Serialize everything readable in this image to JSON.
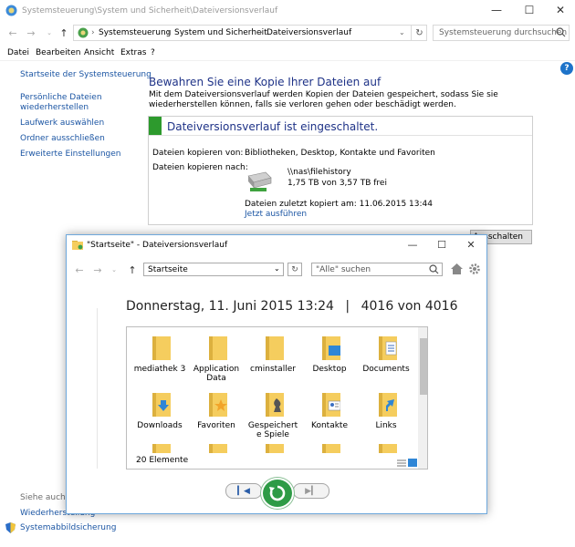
{
  "window": {
    "title": "Systemsteuerung\\System und Sicherheit\\Dateiversionsverlauf",
    "minimize": "—",
    "maximize": "☐",
    "close": "✕"
  },
  "address": {
    "segments": [
      "Systemsteuerung",
      "System und Sicherheit",
      "Dateiversionsverlauf"
    ],
    "search_placeholder": "Systemsteuerung durchsuchen"
  },
  "menu": [
    "Datei",
    "Bearbeiten",
    "Ansicht",
    "Extras",
    "?"
  ],
  "sidebar": {
    "home": "Startseite der Systemsteuerung",
    "links": [
      "Persönliche Dateien wiederherstellen",
      "Laufwerk auswählen",
      "Ordner ausschließen",
      "Erweiterte Einstellungen"
    ],
    "see_also_title": "Siehe auch",
    "see_also": [
      "Wiederherstellung",
      "Systemabbildsicherung"
    ]
  },
  "main": {
    "heading": "Bewahren Sie eine Kopie Ihrer Dateien auf",
    "description": "Mit dem Dateiversionsverlauf werden Kopien der Dateien gespeichert, sodass Sie sie wiederherstellen können, falls sie verloren gehen oder beschädigt werden.",
    "status": "Dateiversionsverlauf ist eingeschaltet.",
    "copy_from_label": "Dateien kopieren von:",
    "copy_from_value": "Bibliotheken, Desktop, Kontakte und Favoriten",
    "copy_to_label": "Dateien kopieren nach:",
    "drive_path": "\\\\nas\\filehistory",
    "drive_space": "1,75 TB von 3,57 TB frei",
    "last_copy": "Dateien zuletzt kopiert am: 11.06.2015 13:44",
    "run_now": "Jetzt ausführen",
    "turn_off": "Ausschalten"
  },
  "history_window": {
    "title": "\"Startseite\" - Dateiversionsverlauf",
    "location": "Startseite",
    "search_placeholder": "\"Alle\" suchen",
    "date": "Donnerstag, 11. Juni 2015 13:24",
    "separator": "|",
    "version": "4016 von 4016",
    "items": [
      {
        "label": "mediathek 3",
        "icon": "folder-icon"
      },
      {
        "label": "Application Data",
        "icon": "folder-icon"
      },
      {
        "label": "cminstaller",
        "icon": "folder-icon"
      },
      {
        "label": "Desktop",
        "icon": "desktop-folder-icon"
      },
      {
        "label": "Documents",
        "icon": "documents-folder-icon"
      },
      {
        "label": "Downloads",
        "icon": "downloads-folder-icon"
      },
      {
        "label": "Favoriten",
        "icon": "favorites-folder-icon"
      },
      {
        "label": "Gespeichert e Spiele",
        "icon": "saved-games-folder-icon"
      },
      {
        "label": "Kontakte",
        "icon": "contacts-folder-icon"
      },
      {
        "label": "Links",
        "icon": "links-folder-icon"
      }
    ],
    "count": "20 Elemente"
  },
  "colors": {
    "accent": "#1b55a3",
    "heading": "#1e3287",
    "status_green": "#2d9a2d",
    "folder": "#f5cd5e"
  }
}
